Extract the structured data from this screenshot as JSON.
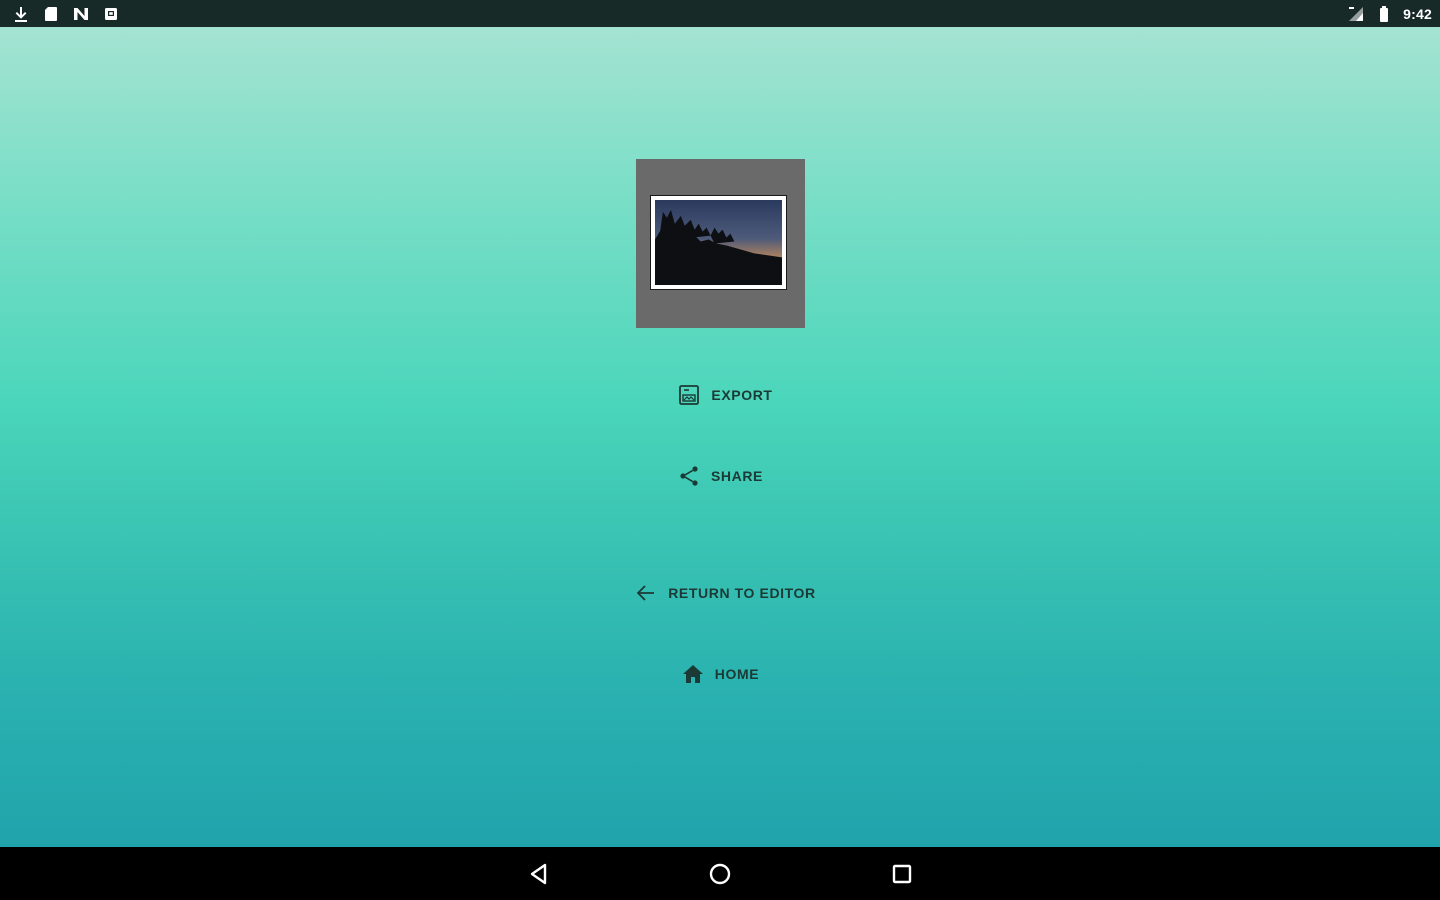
{
  "status_bar": {
    "time": "9:42",
    "left_icons": [
      "download-icon",
      "sd-card-icon",
      "n-logo-icon",
      "notification-box-icon"
    ],
    "right_icons": [
      "signal-icon",
      "battery-icon"
    ]
  },
  "colors": {
    "gradient_top": "#a4e3d2",
    "gradient_mid": "#4ad6bb",
    "gradient_bottom": "#21a3ab",
    "status_bar_bg": "#172a27",
    "nav_bar_bg": "#000000",
    "thumbnail_frame": "#6a6a6a",
    "button_text": "#1c3a35"
  },
  "preview": {
    "image": "sunset-silhouette-photo"
  },
  "actions": {
    "export": {
      "label": "EXPORT",
      "icon": "image-export-icon"
    },
    "share": {
      "label": "SHARE",
      "icon": "share-icon"
    },
    "return_to_editor": {
      "label": "RETURN TO EDITOR",
      "icon": "arrow-back-icon"
    },
    "home": {
      "label": "HOME",
      "icon": "home-icon"
    }
  },
  "nav_bar": {
    "buttons": [
      "back-triangle-icon",
      "home-circle-icon",
      "recents-square-icon"
    ]
  }
}
